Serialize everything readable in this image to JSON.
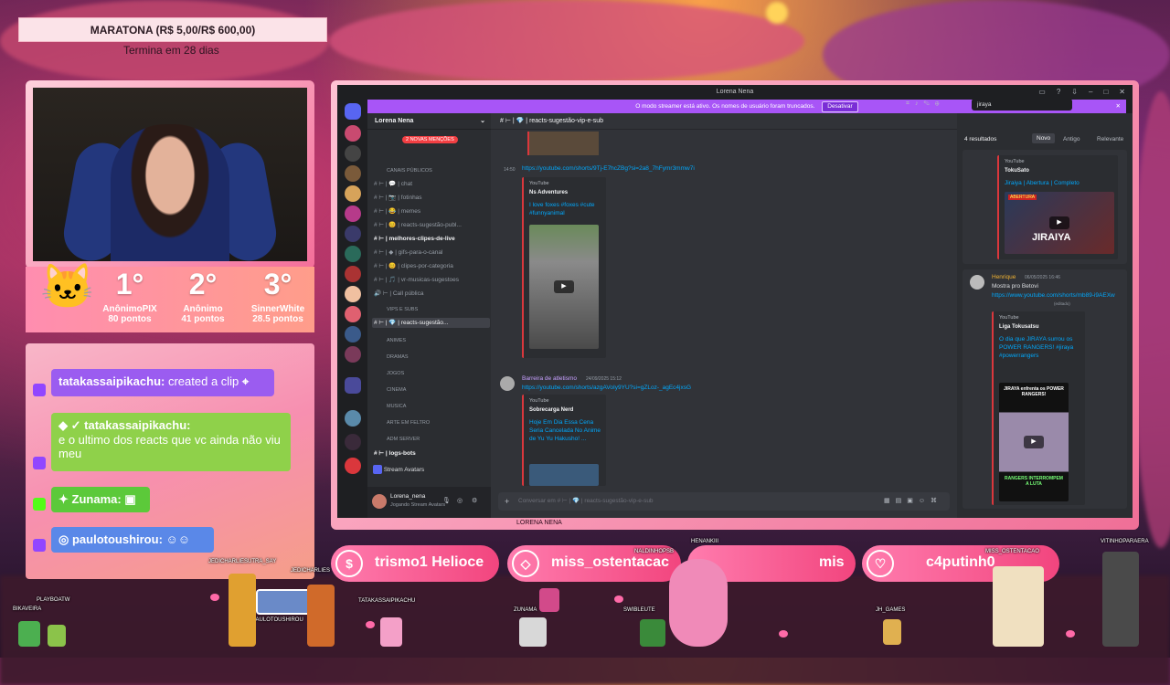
{
  "goal": {
    "title": "MARATONA (R$ 5,00/R$ 600,00)",
    "subtitle": "Termina em 28 dias"
  },
  "leaderboard": [
    {
      "pos": "1°",
      "name": "AnônimoPIX",
      "points": "80 pontos"
    },
    {
      "pos": "2°",
      "name": "Anônimo",
      "points": "41 pontos"
    },
    {
      "pos": "3°",
      "name": "SinnerWhite",
      "points": "28.5 pontos"
    }
  ],
  "chat": [
    {
      "user": "tatakassaipikachu",
      "text": "created a clip",
      "color": "#9b5cf0"
    },
    {
      "user": "tatakassaipikachu:",
      "text": "e o ultimo dos reacts que vc ainda não viu meu",
      "color": "#8fd14a"
    },
    {
      "user": "Zunama:",
      "text": "",
      "color": "#5cc93a"
    },
    {
      "user": "paulotoushirou:",
      "text": "",
      "color": "#5a88e8"
    }
  ],
  "discord": {
    "window_title": "Lorena Nena",
    "banner_text": "O modo streamer está ativo. Os nomes de usuário foram truncados.",
    "banner_button": "Desativar",
    "server_name": "Lorena Nena",
    "mentions_pill": "2 NOVAS MENÇÕES",
    "channel_header": "# ⊢ | 💎 | reacts-sugestão-vip-e-sub",
    "search_value": "jiraya",
    "results_count": "4 resultados",
    "sort_tabs": [
      "Novo",
      "Antigo",
      "Relevante"
    ],
    "channels": [
      {
        "label": "CANAIS PÚBLICOS",
        "kind": "category"
      },
      {
        "label": "# ⊢ | 💬 | chat",
        "kind": "channel"
      },
      {
        "label": "# ⊢ | 📷 | fotinhas",
        "kind": "channel"
      },
      {
        "label": "# ⊢ | 😂 | memes",
        "kind": "channel"
      },
      {
        "label": "# ⊢ | 😊 | reacts-sugestão-publ...",
        "kind": "channel"
      },
      {
        "label": "# ⊢ | melhores-clipes-de-live",
        "kind": "bold"
      },
      {
        "label": "# ⊢ | ◆ | gifs-para-o-canal",
        "kind": "channel"
      },
      {
        "label": "# ⊢ | 😊 | clipes-por-categoria",
        "kind": "channel"
      },
      {
        "label": "# ⊢ | 🎵 | vr-musicas-sugestoes",
        "kind": "channel"
      },
      {
        "label": "🔊 ⊢ | Call pública",
        "kind": "channel"
      },
      {
        "label": "VIPS E SUBS",
        "kind": "category"
      },
      {
        "label": "# ⊢ | 💎 | reacts-sugestão...",
        "kind": "active"
      },
      {
        "label": "ANIMES",
        "kind": "category"
      },
      {
        "label": "DRAMAS",
        "kind": "category"
      },
      {
        "label": "JOGOS",
        "kind": "category"
      },
      {
        "label": "CINEMA",
        "kind": "category"
      },
      {
        "label": "MUSICA",
        "kind": "category"
      },
      {
        "label": "ARTE EM FELTRO",
        "kind": "category"
      },
      {
        "label": "ADM SERVER",
        "kind": "category"
      },
      {
        "label": "# ⊢ | logs-bots",
        "kind": "bold"
      }
    ],
    "stream_avatars": "Stream Avatars",
    "user": {
      "name": "Lorena_nena",
      "status": "Jogando Stream Avatars"
    },
    "messages": {
      "time1": "14:50",
      "link1": "https://youtube.com/shorts/9Tj-E7hcZBg?si=2a8_7hFymr3mmw7i",
      "embed1": {
        "provider": "YouTube",
        "author": "Ns Adventures",
        "title": "I love foxes #foxes #cute #funnyanimal"
      },
      "author2": "Barreira de atletismo",
      "time2": "24/09/2025 15:12",
      "link2": "https://youtube.com/shorts/azgAVoIy9YU?si=gZLoz-_agEc4jxsG",
      "embed2": {
        "provider": "YouTube",
        "author": "Sobrecarga Nerd",
        "title": "Hoje Em Dia Essa Cena Seria Cancelada No Anime de Yu Yu Hakusho! ..."
      }
    },
    "composer_placeholder": "Conversar em # ⊢ | 💎 | reacts-sugestão-vip-e-sub",
    "results": {
      "r1": {
        "provider": "YouTube",
        "author": "TokuSato",
        "title": "Jiraiya | Abertura | Completo",
        "thumb": "JIRAIYA",
        "thumb_top": "ABERTURA"
      },
      "r2": {
        "user": "Henrique",
        "time": "06/05/2025 16:46",
        "text": "Mostra pro Betovi",
        "link": "https://www.youtube.com/shorts/mb89-i9AEXw",
        "edited": "(editado)",
        "provider": "YouTube",
        "author": "Liga Tokusatsu",
        "title": "O dia que JIRAYA surrou os POWER RANGERS! #jiraya #powerrangers",
        "thumb_top": "JIRAYA enfrenta os POWER RANGERS!",
        "thumb_bottom": "RANGERS INTERROMPEM A LUTA"
      }
    }
  },
  "streamer_label": "LORENA NENA",
  "alerts": [
    {
      "text": "trismo1 Helioce",
      "icon": "$"
    },
    {
      "text": "miss_ostentacac",
      "icon": "◇"
    },
    {
      "text": "mis",
      "icon": ""
    },
    {
      "text": "c4putinh0_",
      "icon": "♡"
    }
  ],
  "sprites": [
    "BIKAVEIRA",
    "PLAYBOATW",
    "JEDICHARLIESUTRA_SAY",
    "JEDICHARLIES",
    "PAULOTOUSHIROU",
    "TATAKASSAIPIKACHU",
    "ZUNAMA",
    "NALDINHOPSB",
    "HENANKIII",
    "SWIBLEUTE",
    "MISS_OSTENTACAO",
    "JH_GAMES",
    "VITINHOPARAERA"
  ]
}
